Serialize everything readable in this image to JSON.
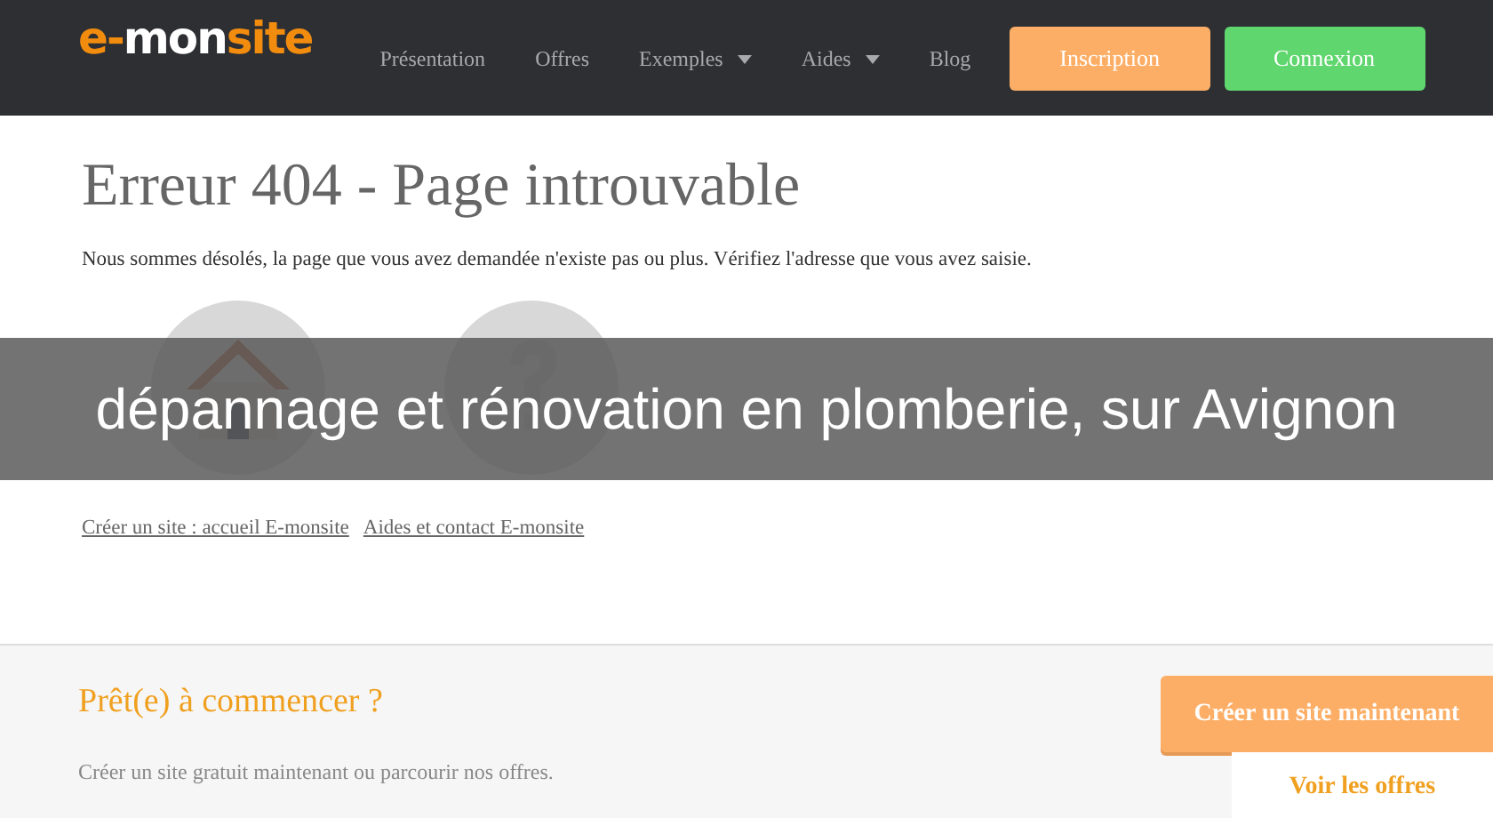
{
  "navbar": {
    "logo": [
      {
        "text": "e-",
        "color": "#f28c0f"
      },
      {
        "text": "mon",
        "color": "#ffffff"
      },
      {
        "text": "site",
        "color": "#f28c0f"
      }
    ],
    "menu": [
      {
        "label": "Présentation",
        "dropdown": false
      },
      {
        "label": "Offres",
        "dropdown": false
      },
      {
        "label": "Exemples",
        "dropdown": true
      },
      {
        "label": "Aides",
        "dropdown": true
      },
      {
        "label": "Blog",
        "dropdown": false
      }
    ],
    "buttons": [
      {
        "label": "Inscription",
        "color": "#fdae66"
      },
      {
        "label": "Connexion",
        "color": "#5fd66e"
      }
    ]
  },
  "error": {
    "title": "Erreur 404 - Page introuvable",
    "message": "Nous sommes désolés, la page que vous avez demandée n'existe pas ou plus. Vérifiez l'adresse que vous avez saisie.",
    "links": [
      "Créer un site : accueil E-monsite",
      "Aides et contact E-monsite"
    ]
  },
  "banner": "dépannage et rénovation en plomberie, sur Avignon",
  "cta": {
    "title": "Prêt(e) à commencer ?",
    "text": "Créer un site gratuit maintenant ou parcourir nos offres.",
    "primary": "Créer un site maintenant",
    "secondary": "Voir les offres"
  }
}
